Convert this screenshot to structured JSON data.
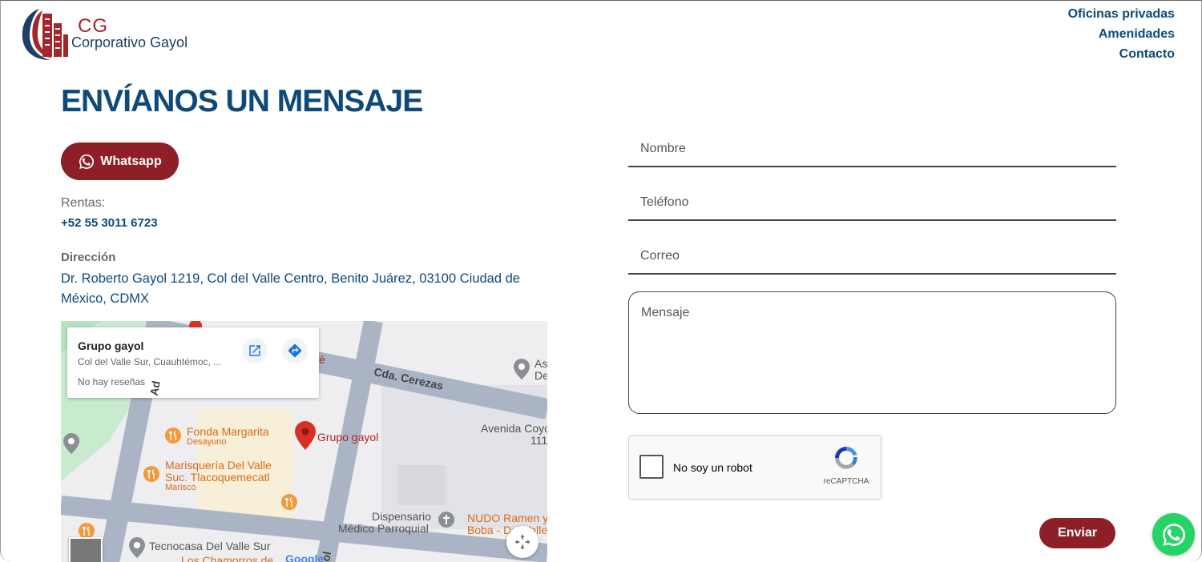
{
  "header": {
    "logo": {
      "initials": "CG",
      "name": "Corporativo Gayol"
    },
    "nav": [
      {
        "label": "Oficinas privadas"
      },
      {
        "label": "Amenidades"
      },
      {
        "label": "Contacto"
      }
    ]
  },
  "contact": {
    "heading": "ENVÍANOS UN MENSAJE",
    "whatsapp_label": "Whatsapp",
    "rentas_label": "Rentas:",
    "rentas_phone": "+52 55 3011 6723",
    "direccion_label": "Dirección",
    "direccion_value": "Dr. Roberto Gayol 1219, Col del Valle Centro, Benito Juárez, 03100 Ciudad de México, CDMX"
  },
  "map": {
    "card": {
      "place_name": "Grupo gayol",
      "address": "Col del Valle Sur, Cuauhtémoc, ...",
      "reviews": "No hay reseñas"
    },
    "labels": {
      "street_cerezas": "Cda. Cerezas",
      "street_left": "Ad",
      "street_bottom": "ol",
      "fonda": "Fonda Margarita",
      "fonda_sub": "Desayuno",
      "marisqueria_1": "Marisquería Del Valle",
      "marisqueria_2": "Suc. Tlacoquemecatl",
      "marisqueria_sub": "Marisco",
      "grupo": "Grupo gayol",
      "avenida": "Avenida Coyo",
      "avenida_num": "111",
      "dispensario_1": "Dispensario",
      "dispensario_2": "Médico Parroquial",
      "nudo_1": "NUDO Ramen y",
      "nudo_2": "Boba - Del Valle",
      "tecnocasa": "Tecnocasa Del Valle Sur",
      "chamorros": "Los Chamorros de",
      "top_right_1": "As",
      "top_right_2": "De",
      "cafe_fragment": "é",
      "google": "Google"
    },
    "colors": {
      "road": "#aab4c4",
      "block": "#e8e8ea",
      "park": "#c8ebd0",
      "pin": "#d93025"
    }
  },
  "form": {
    "nombre_placeholder": "Nombre",
    "telefono_placeholder": "Teléfono",
    "correo_placeholder": "Correo",
    "mensaje_placeholder": "Mensaje",
    "captcha_label": "No soy un robot",
    "captcha_brand": "reCAPTCHA",
    "send_label": "Enviar"
  },
  "colors": {
    "primary_blue": "#0d4a7a",
    "brand_red": "#8e1f27",
    "whatsapp_green": "#25d366"
  },
  "icons": [
    "whatsapp-icon",
    "open-external-icon",
    "directions-icon",
    "map-pin-icon",
    "restaurant-icon",
    "recaptcha-icon",
    "move-icon"
  ]
}
